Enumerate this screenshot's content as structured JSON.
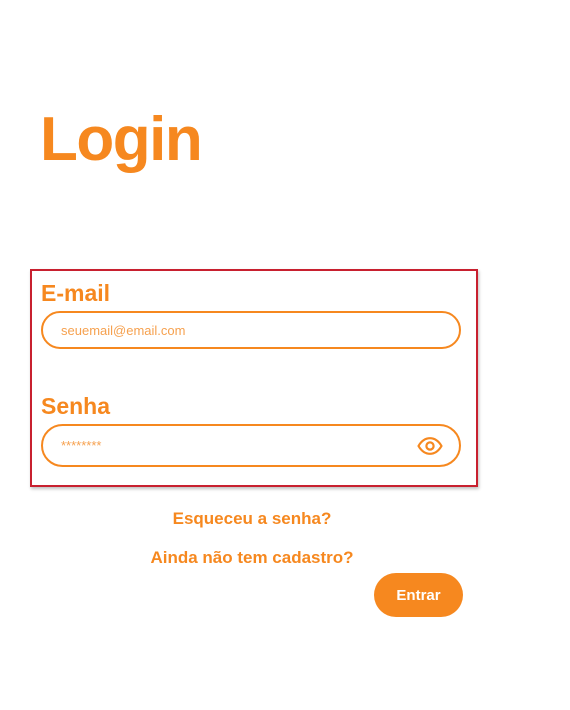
{
  "page": {
    "title": "Login"
  },
  "form": {
    "email_label": "E-mail",
    "email_placeholder": "seuemail@email.com",
    "email_value": "",
    "password_label": "Senha",
    "password_placeholder": "********",
    "password_value": "",
    "password_toggle_icon": "eye-icon"
  },
  "links": {
    "forgot_password": "Esqueceu a senha?",
    "register": "Ainda não tem cadastro?"
  },
  "actions": {
    "submit_label": "Entrar"
  },
  "colors": {
    "accent": "#f6881f",
    "highlight_border": "#c8202f",
    "button_text": "#ffffff",
    "background": "#ffffff"
  }
}
